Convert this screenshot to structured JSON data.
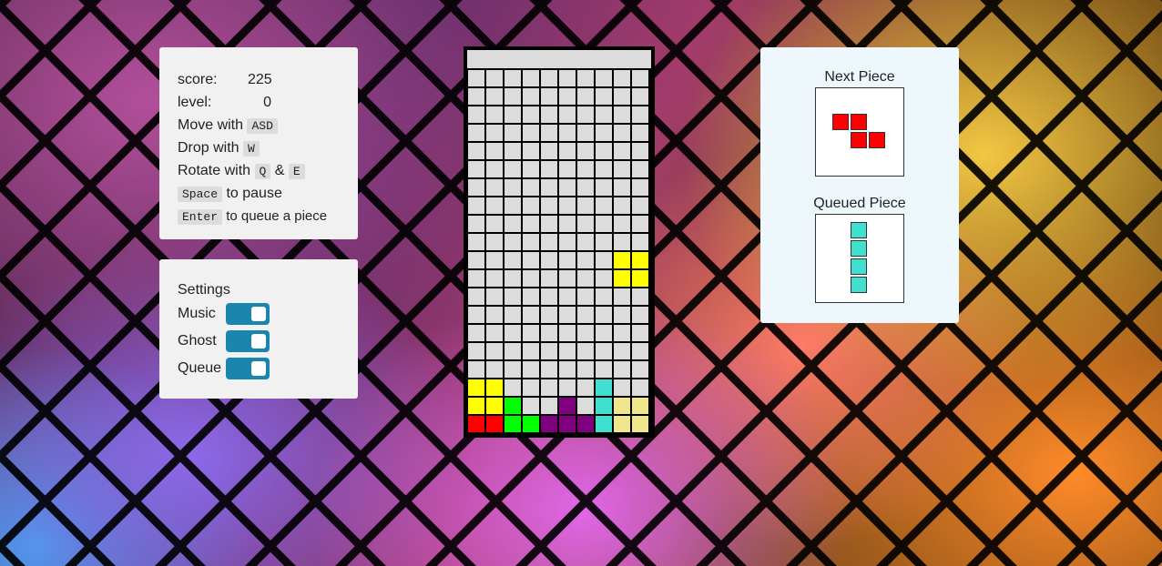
{
  "game": {
    "score_label": "score:",
    "score_value": "225",
    "level_label": "level:",
    "level_value": "0"
  },
  "controls": {
    "move_prefix": "Move with",
    "move_key": "ASD",
    "drop_prefix": "Drop with",
    "drop_key": "W",
    "rotate_prefix": "Rotate with",
    "rotate_key1": "Q",
    "rotate_and": "&",
    "rotate_key2": "E",
    "pause_key": "Space",
    "pause_suffix": "to pause",
    "queue_key": "Enter",
    "queue_suffix": "to queue a piece"
  },
  "settings": {
    "title": "Settings",
    "music_label": "Music",
    "music_on": true,
    "ghost_label": "Ghost",
    "ghost_on": true,
    "queue_label": "Queue",
    "queue_on": true
  },
  "preview": {
    "next_title": "Next Piece",
    "queued_title": "Queued Piece",
    "next_piece": {
      "shape": "Z",
      "color": "#ff0000",
      "cells": [
        [
          0,
          0
        ],
        [
          1,
          0
        ],
        [
          1,
          1
        ],
        [
          2,
          1
        ]
      ]
    },
    "queued_piece": {
      "shape": "I",
      "color": "#40e0d0",
      "cells": [
        [
          0,
          0
        ],
        [
          0,
          1
        ],
        [
          0,
          2
        ],
        [
          0,
          3
        ]
      ]
    }
  },
  "board": {
    "columns": 10,
    "rows": 20,
    "empty_color": "#dcdcdc",
    "filled": [
      {
        "col": 8,
        "row": 10,
        "color": "#ffff00"
      },
      {
        "col": 9,
        "row": 10,
        "color": "#ffff00"
      },
      {
        "col": 8,
        "row": 11,
        "color": "#ffff00"
      },
      {
        "col": 9,
        "row": 11,
        "color": "#ffff00"
      },
      {
        "col": 0,
        "row": 17,
        "color": "#ffff00"
      },
      {
        "col": 1,
        "row": 17,
        "color": "#ffff00"
      },
      {
        "col": 0,
        "row": 18,
        "color": "#ffff00"
      },
      {
        "col": 1,
        "row": 18,
        "color": "#ffff00"
      },
      {
        "col": 0,
        "row": 19,
        "color": "#ff0000"
      },
      {
        "col": 1,
        "row": 19,
        "color": "#ff0000"
      },
      {
        "col": 2,
        "row": 18,
        "color": "#00ff00"
      },
      {
        "col": 2,
        "row": 19,
        "color": "#00ff00"
      },
      {
        "col": 3,
        "row": 19,
        "color": "#00ff00"
      },
      {
        "col": 5,
        "row": 18,
        "color": "#800080"
      },
      {
        "col": 4,
        "row": 19,
        "color": "#800080"
      },
      {
        "col": 5,
        "row": 19,
        "color": "#800080"
      },
      {
        "col": 6,
        "row": 19,
        "color": "#800080"
      },
      {
        "col": 7,
        "row": 17,
        "color": "#40e0d0"
      },
      {
        "col": 7,
        "row": 18,
        "color": "#40e0d0"
      },
      {
        "col": 7,
        "row": 19,
        "color": "#40e0d0"
      },
      {
        "col": 8,
        "row": 18,
        "color": "#f0e68c"
      },
      {
        "col": 9,
        "row": 18,
        "color": "#f0e68c"
      },
      {
        "col": 8,
        "row": 19,
        "color": "#f0e68c"
      },
      {
        "col": 9,
        "row": 19,
        "color": "#f0e68c"
      }
    ]
  }
}
